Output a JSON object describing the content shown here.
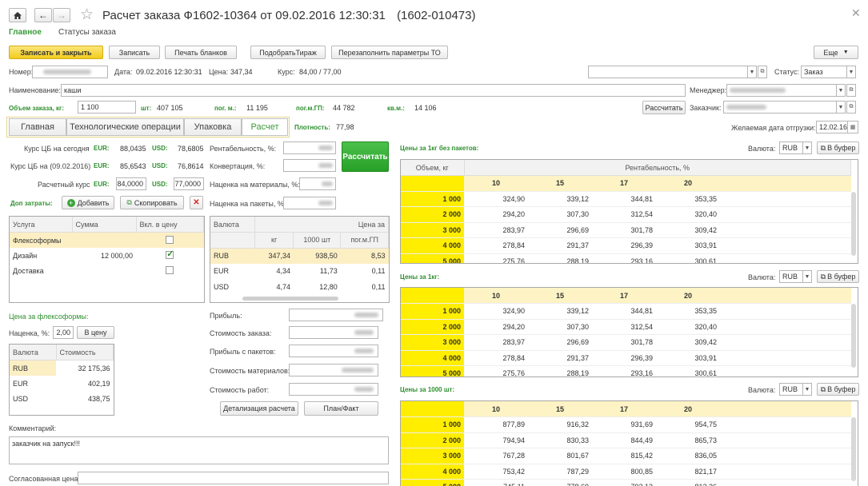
{
  "header": {
    "title": "Расчет заказа Ф1602-10364 от 09.02.2016 12:30:31",
    "code": "(1602-010473)",
    "nav_main": "Главное",
    "nav_status": "Статусы заказа"
  },
  "toolbar": {
    "save_close": "Записать и закрыть",
    "save": "Записать",
    "print": "Печать бланков",
    "pick_run": "ПодобратьТираж",
    "refill": "Перезаполнить параметры ТО",
    "more": "Еще"
  },
  "form": {
    "number_label": "Номер:",
    "date_label": "Дата:",
    "date_value": "09.02.2016 12:30:31",
    "price_label": "Цена:",
    "price_value": "347,34",
    "rate_label": "Курс:",
    "rate_value": "84,00 / 77,00",
    "status_label": "Статус:",
    "status_value": "Заказ",
    "name_label": "Наименование:",
    "name_value": "каши",
    "manager_label": "Менеджер:",
    "volume_label": "Объем заказа, кг:",
    "volume_value": "1 100",
    "pcs_label": "шт:",
    "pcs_value": "407 105",
    "pogm_label": "пог. м.:",
    "pogm_value": "11 195",
    "pogmgp_label": "пог.м.ГП:",
    "pogmgp_value": "44 782",
    "sqm_label": "кв.м.:",
    "sqm_value": "14 106",
    "calc_btn": "Рассчитать",
    "customer_label": "Заказчик:",
    "density_label": "Плотность:",
    "density_value": "77,98",
    "ship_date_label": "Желаемая дата отгрузки:",
    "ship_date_value": "12.02.16"
  },
  "tabs": [
    "Главная",
    "Технологические операции",
    "Упаковка",
    "Расчет"
  ],
  "rates": {
    "today_label": "Курс ЦБ на сегодня",
    "today_eur": "88,0435",
    "today_usd": "78,6805",
    "date_label": "Курс ЦБ на (09.02.2016)",
    "date_eur": "85,6543",
    "date_usd": "76,8614",
    "calc_label": "Расчетный курс",
    "calc_eur": "84,0000",
    "calc_usd": "77,0000",
    "eur": "EUR:",
    "usd": "USD:"
  },
  "params": {
    "profit_label": "Рентабельность, %:",
    "conv_label": "Конвертация, %:",
    "markup_mat_label": "Наценка на материалы, %:",
    "markup_pack_label": "Наценка на пакеты, %:",
    "calc_big_btn": "Рассчитать"
  },
  "extra": {
    "label": "Доп затраты:",
    "add": "Добавить",
    "copy": "Скопировать",
    "cols": [
      "Услуга",
      "Сумма",
      "Вкл. в цену"
    ],
    "rows": [
      {
        "service": "Флексоформы",
        "sum": "",
        "checked": false
      },
      {
        "service": "Дизайн",
        "sum": "12 000,00",
        "checked": true
      },
      {
        "service": "Доставка",
        "sum": "",
        "checked": false
      }
    ]
  },
  "currency_table": {
    "col_currency": "Валюта",
    "col_price_for": "Цена за",
    "sub": [
      "кг",
      "1000 шт",
      "пог.м.ГП"
    ],
    "rows": [
      {
        "cur": "RUB",
        "kg": "347,34",
        "k": "938,50",
        "m": "8,53"
      },
      {
        "cur": "EUR",
        "kg": "4,34",
        "k": "11,73",
        "m": "0,11"
      },
      {
        "cur": "USD",
        "kg": "4,74",
        "k": "12,80",
        "m": "0,11"
      }
    ]
  },
  "flexo": {
    "title": "Цена за флексоформы:",
    "markup_label": "Наценка, %:",
    "markup_value": "2,00",
    "to_price": "В цену",
    "cols": [
      "Валюта",
      "Стоимость"
    ],
    "rows": [
      {
        "cur": "RUB",
        "cost": "32 175,36"
      },
      {
        "cur": "EUR",
        "cost": "402,19"
      },
      {
        "cur": "USD",
        "cost": "438,75"
      }
    ]
  },
  "totals": {
    "profit": "Прибыль:",
    "order_cost": "Стоимость заказа:",
    "pack_profit": "Прибыль с пакетов:",
    "mat_cost": "Стоимость материалов:",
    "work_cost": "Стоимость работ:",
    "detail_btn": "Детализация расчета",
    "plan_btn": "План/Факт"
  },
  "comment": {
    "label": "Комментарий:",
    "value": "заказчик на запуск!!!",
    "agreed_label": "Согласованная цена:"
  },
  "price_tables": {
    "currency_label": "Валюта:",
    "currency_value": "RUB",
    "buffer_btn": "В буфер",
    "volume_col": "Объем, кг",
    "profit_col": "Рентабельность, %",
    "cols": [
      "10",
      "15",
      "17",
      "20"
    ],
    "t1": {
      "title": "Цены за 1кг без пакетов:",
      "rows": [
        {
          "v": "1 000",
          "c": [
            "324,90",
            "339,12",
            "344,81",
            "353,35"
          ]
        },
        {
          "v": "2 000",
          "c": [
            "294,20",
            "307,30",
            "312,54",
            "320,40"
          ]
        },
        {
          "v": "3 000",
          "c": [
            "283,97",
            "296,69",
            "301,78",
            "309,42"
          ]
        },
        {
          "v": "4 000",
          "c": [
            "278,84",
            "291,37",
            "296,39",
            "303,91"
          ]
        },
        {
          "v": "5 000",
          "c": [
            "275,76",
            "288,19",
            "293,16",
            "300,61"
          ]
        }
      ]
    },
    "t2": {
      "title": "Цены за 1кг:",
      "rows": [
        {
          "v": "1 000",
          "c": [
            "324,90",
            "339,12",
            "344,81",
            "353,35"
          ]
        },
        {
          "v": "2 000",
          "c": [
            "294,20",
            "307,30",
            "312,54",
            "320,40"
          ]
        },
        {
          "v": "3 000",
          "c": [
            "283,97",
            "296,69",
            "301,78",
            "309,42"
          ]
        },
        {
          "v": "4 000",
          "c": [
            "278,84",
            "291,37",
            "296,39",
            "303,91"
          ]
        },
        {
          "v": "5 000",
          "c": [
            "275,76",
            "288,19",
            "293,16",
            "300,61"
          ]
        }
      ]
    },
    "t3": {
      "title": "Цены за 1000 шт:",
      "rows": [
        {
          "v": "1 000",
          "c": [
            "877,89",
            "916,32",
            "931,69",
            "954,75"
          ]
        },
        {
          "v": "2 000",
          "c": [
            "794,94",
            "830,33",
            "844,49",
            "865,73"
          ]
        },
        {
          "v": "3 000",
          "c": [
            "767,28",
            "801,67",
            "815,42",
            "836,05"
          ]
        },
        {
          "v": "4 000",
          "c": [
            "753,42",
            "787,29",
            "800,85",
            "821,17"
          ]
        },
        {
          "v": "5 000",
          "c": [
            "745,11",
            "778,69",
            "792,13",
            "812,36"
          ]
        }
      ]
    }
  }
}
